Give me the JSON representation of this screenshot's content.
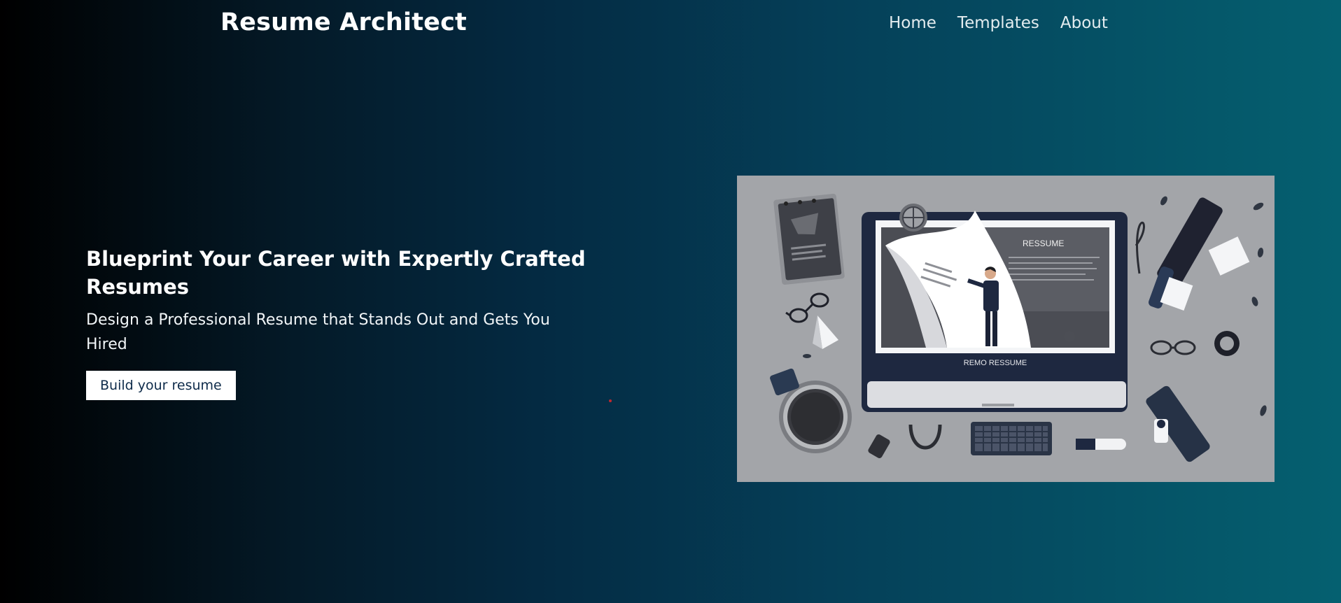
{
  "brand": {
    "title": "Resume Architect"
  },
  "nav": {
    "items": [
      {
        "label": "Home"
      },
      {
        "label": "Templates"
      },
      {
        "label": "About"
      }
    ]
  },
  "hero": {
    "heading": "Blueprint Your Career with Expertly Crafted Resumes",
    "subheading": "Design a Professional Resume that Stands Out and Gets You Hired",
    "cta_label": "Build your resume"
  },
  "illustration": {
    "screen_title": "RESSUME",
    "monitor_label": "REMO RESSUME"
  },
  "colors": {
    "background_start": "#000000",
    "background_end": "#056070",
    "button_bg": "#ffffff",
    "button_text": "#0e2b4a",
    "illustration_bg": "#a3a5a9",
    "accent_dot": "#c0282e"
  }
}
